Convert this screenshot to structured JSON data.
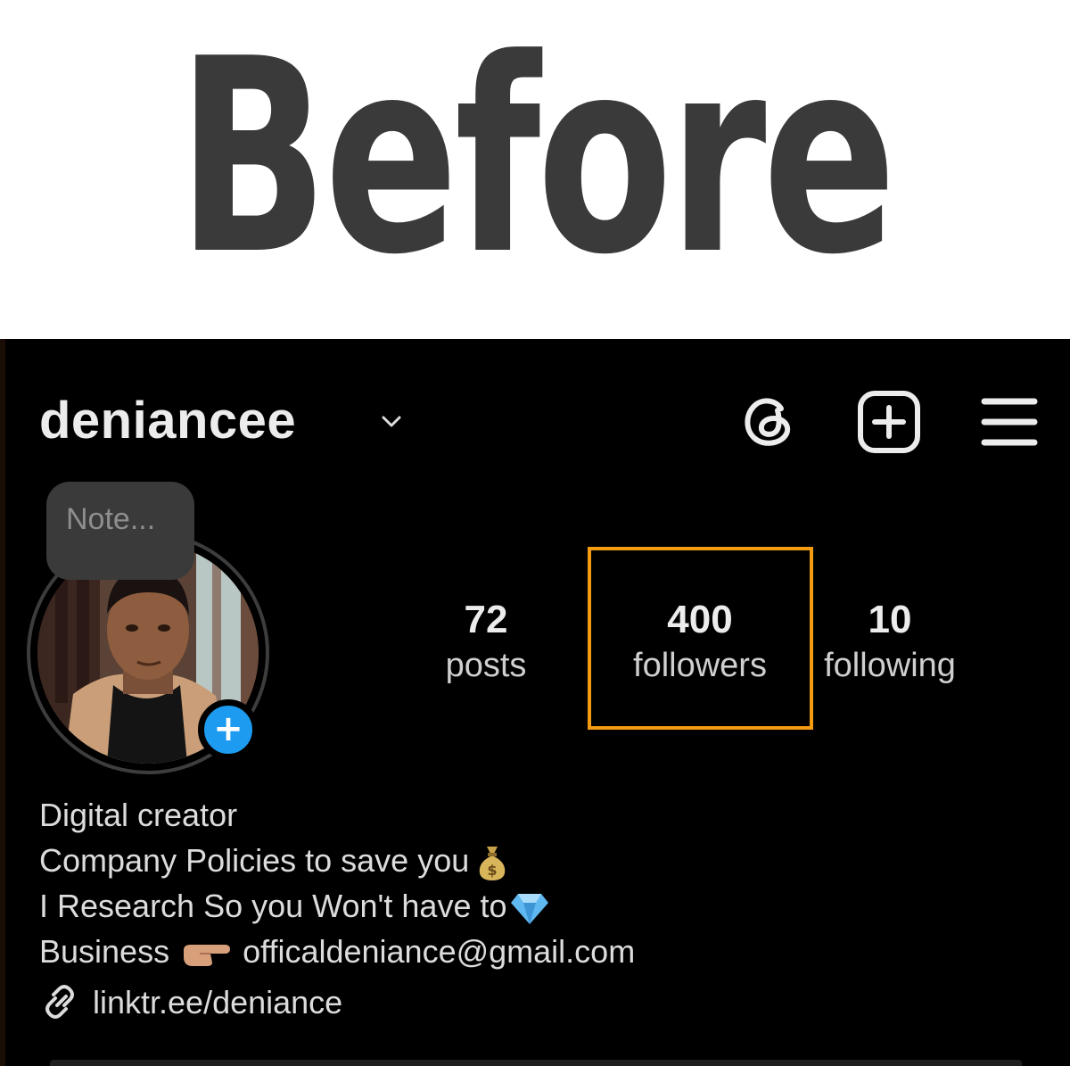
{
  "banner": {
    "title": "Before"
  },
  "profile": {
    "username": "deniancee",
    "note_placeholder": "Note...",
    "add_story_symbol": "+"
  },
  "stats": {
    "posts": {
      "value": "72",
      "label": "posts"
    },
    "followers": {
      "value": "400",
      "label": "followers"
    },
    "following": {
      "value": "10",
      "label": "following"
    }
  },
  "bio": {
    "line1": "Digital creator",
    "line2": "Company Policies to save you",
    "line3": "I Research So you Won't have to",
    "line4_prefix": "Business",
    "line4_email": "officaldeniance@gmail.com",
    "link": "linktr.ee/deniance"
  },
  "icons": {
    "header": [
      "threads-icon",
      "create-post-icon",
      "menu-icon"
    ],
    "bio": [
      "money-bag-emoji",
      "gem-emoji",
      "pointing-hand-emoji",
      "link-icon"
    ]
  },
  "colors": {
    "highlight": "#f39c12",
    "story_add": "#1d9bf0",
    "background": "#000000",
    "banner_text": "#3a3a3a"
  }
}
